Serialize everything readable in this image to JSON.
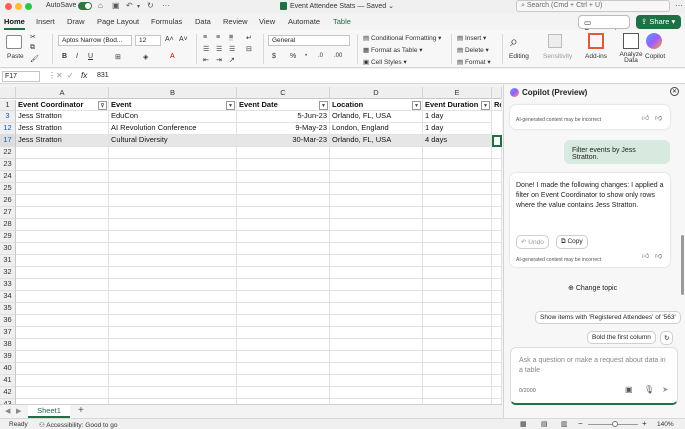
{
  "titlebar": {
    "autosave_label": "AutoSave",
    "doc_title": "Event Attendee Stats — Saved",
    "search_placeholder": "Search (Cmd + Ctrl + U)"
  },
  "ribbon_tabs": [
    "Home",
    "Insert",
    "Draw",
    "Page Layout",
    "Formulas",
    "Data",
    "Review",
    "View",
    "Automate",
    "Table"
  ],
  "comments_label": "Comments",
  "share_label": "Share",
  "ribbon": {
    "paste_label": "Paste",
    "font_name": "Aptos Narrow (Bod...",
    "font_size": "12",
    "number_format": "General",
    "conditional_formatting": "Conditional Formatting",
    "format_as_table": "Format as Table",
    "cell_styles": "Cell Styles",
    "insert": "Insert",
    "delete": "Delete",
    "format": "Format",
    "editing": "Editing",
    "sensitivity": "Sensitivity",
    "addins": "Add-ins",
    "analyze_data": "Analyze Data",
    "copilot": "Copilot"
  },
  "formula_bar": {
    "name_box": "F17",
    "fx": "fx",
    "content": "831"
  },
  "grid": {
    "columns": [
      "A",
      "B",
      "C",
      "D",
      "E"
    ],
    "headers": [
      "Event Coordinator",
      "Event",
      "Event Date",
      "Location",
      "Event Duration",
      "Re"
    ],
    "rows": [
      {
        "num": "3",
        "cells": [
          "Jess Stratton",
          "EduCon",
          "5-Jun-23",
          "Orlando, FL, USA",
          "1 day"
        ]
      },
      {
        "num": "12",
        "cells": [
          "Jess Stratton",
          "AI Revolution Conference",
          "9-May-23",
          "London, England",
          "1 day"
        ]
      },
      {
        "num": "17",
        "cells": [
          "Jess Stratton",
          "Cultural Diversity",
          "30-Mar-23",
          "Orlando, FL, USA",
          "4 days"
        ]
      }
    ],
    "empty_rows": [
      "22",
      "23",
      "24",
      "25",
      "26",
      "27",
      "28",
      "29",
      "30",
      "31",
      "32",
      "33",
      "34",
      "35",
      "36",
      "37",
      "38",
      "39",
      "40",
      "41",
      "42",
      "43"
    ]
  },
  "sheet_tab": "Sheet1",
  "status": {
    "ready": "Ready",
    "accessibility": "Accessibility: Good to go",
    "zoom": "140%"
  },
  "copilot": {
    "title": "Copilot (Preview)",
    "disclaimer": "AI-generated content may be incorrect",
    "user_message": "Filter events by Jess Stratton.",
    "ai_message": "Done! I made the following changes: I applied a filter on Event Coordinator to show only rows where the value contains Jess Stratton.",
    "undo_label": "Undo",
    "copy_label": "Copy",
    "change_topic": "Change topic",
    "suggestion1": "Show items with 'Registered Attendees' of '563'",
    "suggestion2": "Bold the first column",
    "input_placeholder": "Ask a question or make a request about data in a table",
    "char_count": "0/2000"
  }
}
